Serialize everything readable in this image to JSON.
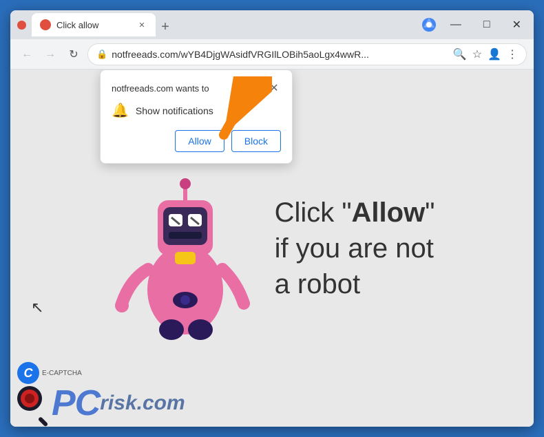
{
  "window": {
    "title": "Click allow",
    "minimize_label": "—",
    "maximize_label": "□",
    "close_label": "✕"
  },
  "tab": {
    "title": "Click allow",
    "new_tab_label": "+"
  },
  "url_bar": {
    "url": "notfreeads.com/wYB4DjgWAsidfVRGIlLOBih5aoLgx4wwR...",
    "url_prefix": "notfreeads.com",
    "url_suffix": "/wYB4DjgWAsidfVRGIlLOBih5aoLgx4wwR...",
    "back_label": "←",
    "forward_label": "→",
    "refresh_label": "↻"
  },
  "notification_popup": {
    "site_text": "notfreeads.com wants to",
    "notification_label": "Show notifications",
    "allow_button": "Allow",
    "block_button": "Block",
    "close_label": "✕"
  },
  "site_content": {
    "main_text_line1": "Click \"",
    "main_text_bold": "Allow",
    "main_text_line2": "\"",
    "main_text_line3": "if you are not",
    "main_text_line4": "a robot"
  },
  "bottom_logo": {
    "pcrisk_text": "PCrisk.com"
  },
  "colors": {
    "accent_blue": "#1a73e8",
    "browser_bg": "#dee1e6",
    "tab_active_bg": "#ffffff",
    "chrome_blue": "#2a6ebb"
  }
}
